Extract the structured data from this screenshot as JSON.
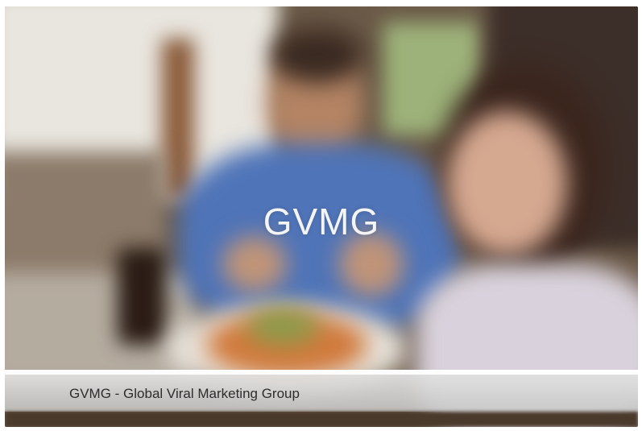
{
  "slide": {
    "logo_text": "GVMG",
    "caption": "GVMG - Global Viral Marketing Group",
    "photo_description_icon": "restaurant-photo"
  },
  "colors": {
    "shirt_blue": "#4f74b8",
    "caption_bar": "#d9d9d9",
    "caption_text": "#2d2d2d",
    "logo_text": "#f4f4f4"
  }
}
